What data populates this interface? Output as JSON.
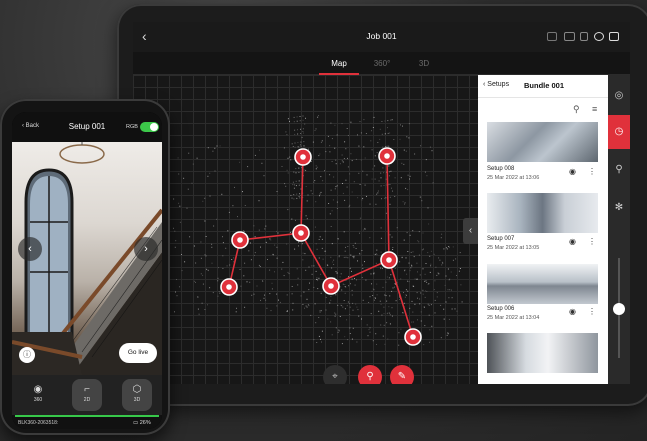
{
  "tablet": {
    "title": "Job 001",
    "back_icon": "chevron-left",
    "tabs": [
      {
        "label": "Map",
        "active": true
      },
      {
        "label": "360°",
        "active": false
      },
      {
        "label": "3D",
        "active": false
      }
    ],
    "status_icons": [
      "link-icon",
      "battery-icon",
      "sd-card-icon",
      "help-icon",
      "building-icon"
    ],
    "map": {
      "setup_markers": 9,
      "toolbar": [
        "target-icon",
        "pin-icon",
        "measure-icon"
      ]
    },
    "panel": {
      "back_label": "Setups",
      "title": "Bundle 001",
      "setups": [
        {
          "name": "Setup 008",
          "date": "25 Mar 2022 at 13:06"
        },
        {
          "name": "Setup 007",
          "date": "25 Mar 2022 at 13:05"
        },
        {
          "name": "Setup 006",
          "date": "25 Mar 2022 at 13:04"
        },
        {
          "name": "",
          "date": ""
        }
      ]
    },
    "rail": [
      "layers-icon",
      "location-icon",
      "pin-icon",
      "settings-icon"
    ],
    "accent": "#e0313b"
  },
  "phone": {
    "back_label": "Back",
    "title": "Setup 001",
    "rgb_label": "RGB",
    "rgb_on": true,
    "go_live_label": "Go live",
    "modes": [
      {
        "label": "360",
        "icon": "panorama-icon",
        "selected": false
      },
      {
        "label": "2D",
        "icon": "floorplan-icon",
        "selected": true
      },
      {
        "label": "3D",
        "icon": "cube-icon",
        "selected": false
      }
    ],
    "device_serial": "BLK360-2063518:",
    "battery": "26%",
    "accent_green": "#37c84a"
  }
}
